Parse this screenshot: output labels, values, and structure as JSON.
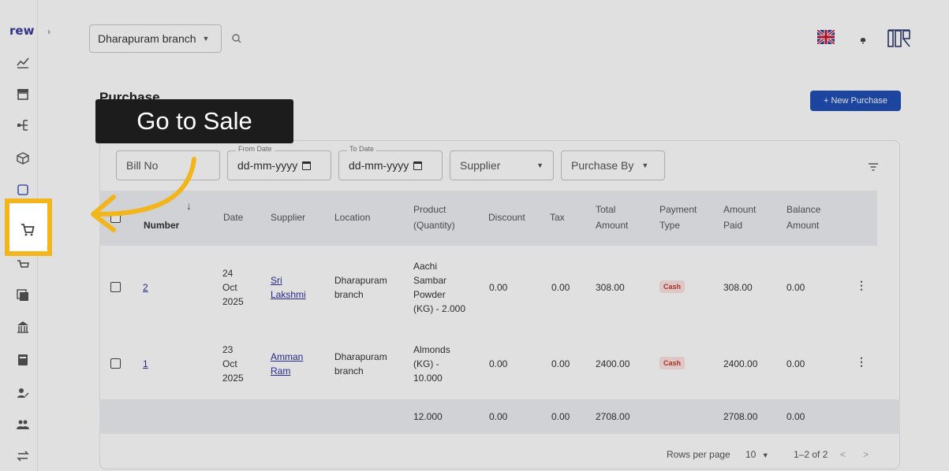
{
  "brand": {
    "logo_text": "rew"
  },
  "topbar": {
    "branch_value": "Dharapuram branch",
    "icons": [
      "search-icon",
      "uk-flag-icon",
      "bell-icon",
      "avatar"
    ]
  },
  "page": {
    "title": "Purchase",
    "new_button": "+ New Purchase"
  },
  "filters": {
    "bill_no_placeholder": "Bill No",
    "from_date_label": "From Date",
    "from_date_value": "dd-mm-yyyy",
    "to_date_label": "To Date",
    "to_date_value": "dd-mm-yyyy",
    "supplier_placeholder": "Supplier",
    "purchase_by_placeholder": "Purchase By"
  },
  "table": {
    "columns": {
      "number": "Number",
      "date": "Date",
      "supplier": "Supplier",
      "location": "Location",
      "product_l1": "Product",
      "product_l2": "(Quantity)",
      "discount": "Discount",
      "tax": "Tax",
      "total_l1": "Total",
      "total_l2": "Amount",
      "payment_l1": "Payment",
      "payment_l2": "Type",
      "paid_l1": "Amount",
      "paid_l2": "Paid",
      "balance_l1": "Balance",
      "balance_l2": "Amount"
    },
    "rows": [
      {
        "number": "2",
        "date": [
          "24",
          "Oct",
          "2025"
        ],
        "supplier": [
          "Sri",
          "Lakshmi"
        ],
        "location": [
          "Dharapuram",
          "branch"
        ],
        "product": [
          "Aachi",
          "Sambar",
          "Powder",
          "(KG) - 2.000"
        ],
        "discount": "0.00",
        "tax": "0.00",
        "total": "308.00",
        "payment": "Cash",
        "paid": "308.00",
        "balance": "0.00"
      },
      {
        "number": "1",
        "date": [
          "23",
          "Oct",
          "2025"
        ],
        "supplier": [
          "Amman",
          "Ram"
        ],
        "location": [
          "Dharapuram",
          "branch"
        ],
        "product": [
          "Almonds",
          "(KG) -",
          "10.000"
        ],
        "discount": "0.00",
        "tax": "0.00",
        "total": "2400.00",
        "payment": "Cash",
        "paid": "2400.00",
        "balance": "0.00"
      }
    ],
    "totals": {
      "quantity": "12.000",
      "discount": "0.00",
      "tax": "0.00",
      "total": "2708.00",
      "paid": "2708.00",
      "balance": "0.00"
    }
  },
  "pagination": {
    "rows_per_page_label": "Rows per page",
    "rows_per_page_value": "10",
    "range": "1–2 of 2"
  },
  "tutorial": {
    "tooltip": "Go to Sale",
    "accent_color": "#f2b51c"
  }
}
